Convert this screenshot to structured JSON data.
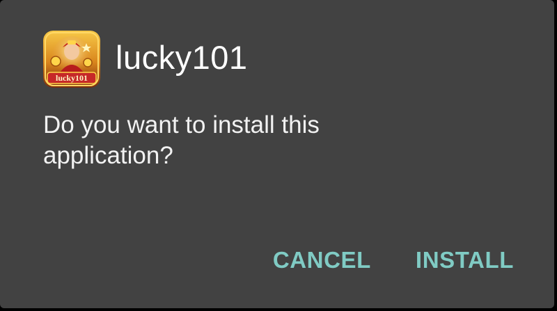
{
  "dialog": {
    "app_name": "lucky101",
    "icon": {
      "name": "lucky101-app-icon",
      "label": "lucky101"
    },
    "message": "Do you want to install this application?",
    "buttons": {
      "cancel_label": "CANCEL",
      "install_label": "INSTALL"
    }
  },
  "colors": {
    "dialog_background": "#424242",
    "text_primary": "#ffffff",
    "button_accent": "#80cbc4"
  }
}
